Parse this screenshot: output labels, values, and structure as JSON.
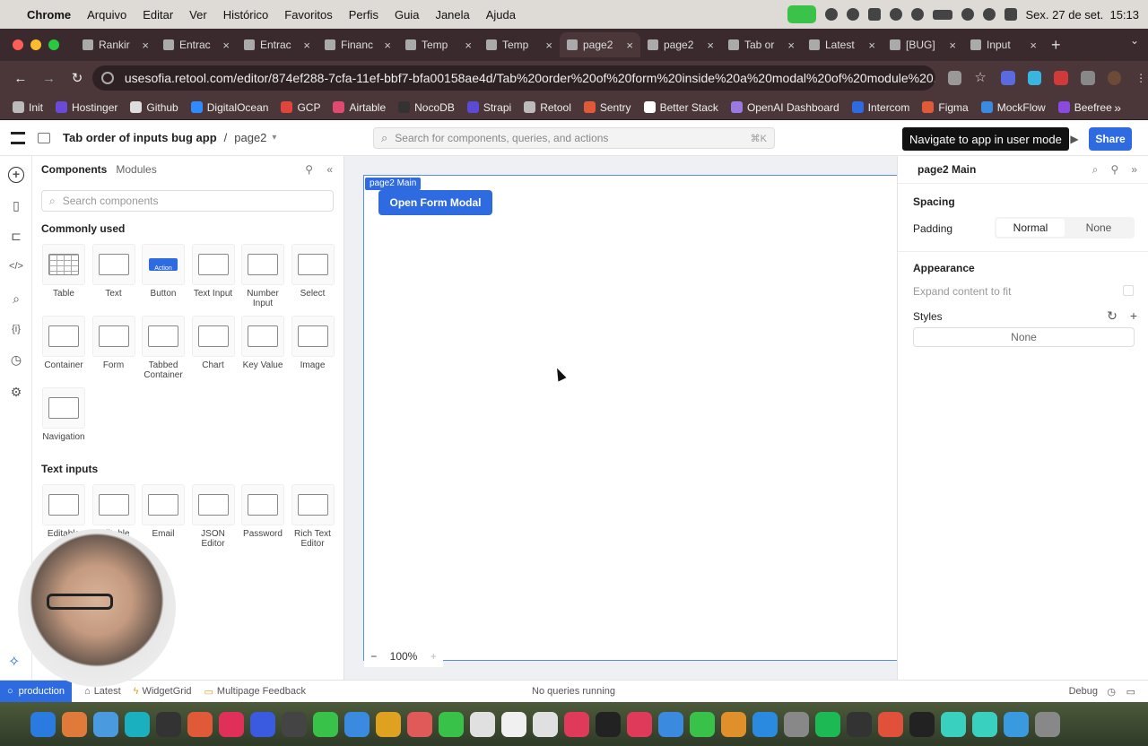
{
  "menubar": {
    "app": "Chrome",
    "items": [
      "Arquivo",
      "Editar",
      "Ver",
      "Histórico",
      "Favoritos",
      "Perfis",
      "Guia",
      "Janela",
      "Ajuda"
    ],
    "datetime": "Sex. 27 de set.  15:13"
  },
  "tabs": [
    {
      "label": "Rankir",
      "active": false
    },
    {
      "label": "Entrac",
      "active": false
    },
    {
      "label": "Entrac",
      "active": false
    },
    {
      "label": "Financ",
      "active": false
    },
    {
      "label": "Temp",
      "active": false
    },
    {
      "label": "Temp",
      "active": false
    },
    {
      "label": "page2",
      "active": true
    },
    {
      "label": "page2",
      "active": false
    },
    {
      "label": "Tab or",
      "active": false
    },
    {
      "label": "Latest",
      "active": false
    },
    {
      "label": "[BUG]",
      "active": false
    },
    {
      "label": "Input",
      "active": false
    }
  ],
  "address": {
    "url": "usesofia.retool.com/editor/874ef288-7cfa-11ef-bbf7-bfa00158ae4d/Tab%20order%20of%20form%20inside%20a%20modal%20of%20module%20..."
  },
  "bookmarks": [
    "Init",
    "Hostinger",
    "Github",
    "DigitalOcean",
    "GCP",
    "Airtable",
    "NocoDB",
    "Strapi",
    "Retool",
    "Sentry",
    "Better Stack",
    "OpenAI Dashboard",
    "Intercom",
    "Figma",
    "MockFlow",
    "Beefree"
  ],
  "header": {
    "app_title": "Tab order of inputs bug app",
    "separator": "/",
    "page": "page2",
    "search_placeholder": "Search for components, queries, and actions",
    "search_shortcut": "⌘K",
    "tooltip": "Navigate to app in user mode",
    "share": "Share"
  },
  "components_panel": {
    "tab_components": "Components",
    "tab_modules": "Modules",
    "search_placeholder": "Search components",
    "commonly_used_title": "Commonly used",
    "commonly_used": [
      "Table",
      "Text",
      "Button",
      "Text Input",
      "Number Input",
      "Select",
      "Container",
      "Form",
      "Tabbed Container",
      "Chart",
      "Key Value",
      "Image",
      "Navigation"
    ],
    "button_thumb_text": "Action",
    "text_inputs_title": "Text inputs",
    "text_inputs": [
      "Editable",
      "Editable",
      "Email",
      "JSON Editor",
      "Password",
      "Rich Text Editor"
    ]
  },
  "canvas": {
    "frame_label": "page2 Main",
    "open_button": "Open Form Modal",
    "zoom": "100%"
  },
  "inspector": {
    "title": "page2 Main",
    "spacing_title": "Spacing",
    "padding_label": "Padding",
    "padding_options": [
      "Normal",
      "None"
    ],
    "padding_selected": "Normal",
    "appearance_title": "Appearance",
    "expand_label": "Expand content to fit",
    "styles_label": "Styles",
    "styles_value": "None"
  },
  "status": {
    "env": "production",
    "latest": "Latest",
    "widgetgrid": "WidgetGrid",
    "feedback": "Multipage Feedback",
    "queries": "No queries running",
    "debug": "Debug"
  },
  "colors": {
    "accent": "#2f6be0"
  }
}
